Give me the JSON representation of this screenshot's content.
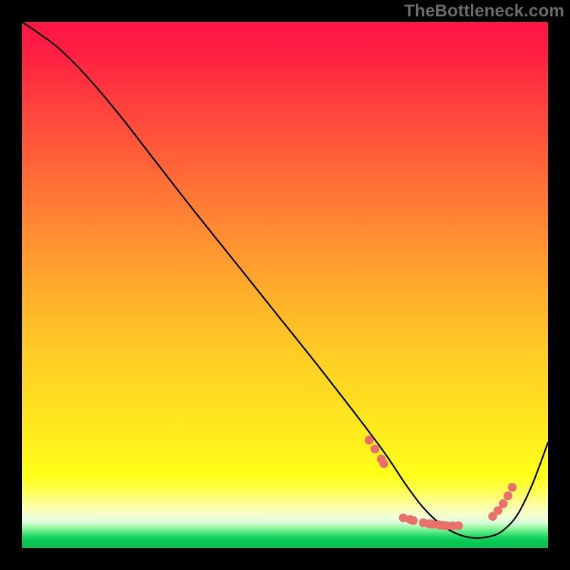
{
  "watermark": "TheBottleneck.com",
  "chart_data": {
    "type": "line",
    "title": "",
    "xlabel": "",
    "ylabel": "",
    "xlim": [
      0,
      100
    ],
    "ylim": [
      0,
      100
    ],
    "grid": false,
    "series": [
      {
        "name": "curve",
        "x": [
          0,
          3,
          7,
          12,
          18,
          25,
          32,
          40,
          48,
          56,
          63,
          69,
          73,
          76,
          79,
          82,
          85,
          88,
          91,
          94,
          97,
          100
        ],
        "y": [
          100,
          98,
          95,
          90,
          83,
          74,
          65,
          55,
          45,
          35,
          26,
          18,
          12,
          8,
          5,
          3,
          2,
          2,
          3,
          6,
          12,
          20
        ]
      }
    ],
    "markers": {
      "name": "highlight-dots",
      "color": "#e9706b",
      "points_x": [
        66.0,
        67.1,
        68.3,
        68.8,
        72.5,
        73.8,
        74.4,
        76.3,
        77.4,
        78.0,
        79.2,
        79.7,
        80.2,
        80.8,
        81.9,
        83.0,
        89.5,
        90.5,
        91.5,
        92.4,
        93.2
      ],
      "points_y": [
        20.5,
        18.8,
        16.9,
        16.0,
        5.7,
        5.4,
        5.2,
        4.8,
        4.6,
        4.5,
        4.4,
        4.3,
        4.3,
        4.2,
        4.2,
        4.2,
        6.0,
        7.1,
        8.4,
        9.9,
        11.5
      ]
    },
    "gradient_stops": [
      {
        "pos": 0.0,
        "color": "#ff1646"
      },
      {
        "pos": 0.3,
        "color": "#ff7a35"
      },
      {
        "pos": 0.6,
        "color": "#ffce25"
      },
      {
        "pos": 0.86,
        "color": "#ffff1a"
      },
      {
        "pos": 0.95,
        "color": "#d6ffdc"
      },
      {
        "pos": 1.0,
        "color": "#05c050"
      }
    ]
  }
}
